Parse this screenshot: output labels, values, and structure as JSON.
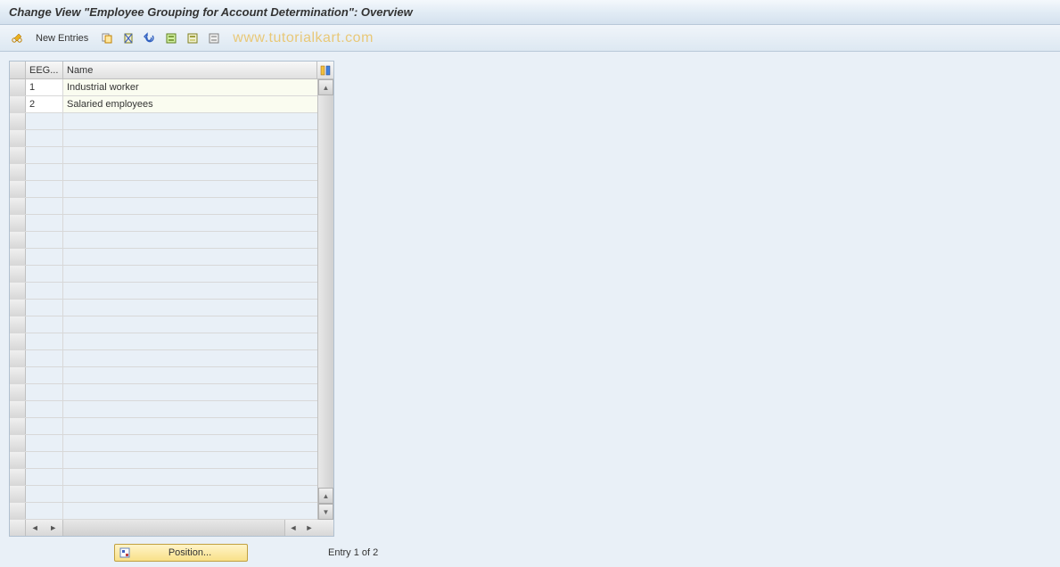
{
  "title": "Change View \"Employee Grouping for Account Determination\": Overview",
  "toolbar": {
    "new_entries_label": "New Entries"
  },
  "watermark": "www.tutorialkart.com",
  "table": {
    "columns": {
      "eeg": "EEG...",
      "name": "Name"
    },
    "rows": [
      {
        "eeg": "1",
        "name": "Industrial worker"
      },
      {
        "eeg": "2",
        "name": "Salaried employees"
      }
    ],
    "empty_row_count": 24
  },
  "footer": {
    "position_label": "Position...",
    "entry_text": "Entry 1 of 2"
  }
}
